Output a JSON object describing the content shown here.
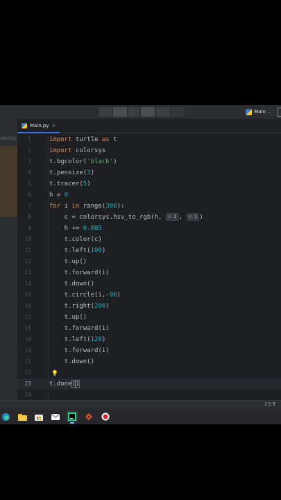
{
  "toolbar": {
    "run_config_label": "Main"
  },
  "project_panel": {
    "label": "ojects/p"
  },
  "tab": {
    "filename": "Main.py",
    "close_glyph": "×"
  },
  "editor": {
    "line_numbers": [
      "1",
      "2",
      "3",
      "4",
      "5",
      "6",
      "7",
      "8",
      "9",
      "10",
      "11",
      "12",
      "13",
      "14",
      "15",
      "16",
      "17",
      "18",
      "19",
      "20",
      "21",
      "22",
      "23",
      "24"
    ],
    "current_line": 23,
    "code_lines": [
      "import turtle as t",
      "import colorsys",
      "t.bgcolor('black')",
      "t.pensize(3)",
      "t.tracer(5)",
      "h = 0",
      "for i in range(300):",
      "    c = colorsys.hsv_to_rgb(h, s: 1, v: 1)",
      "    h += 0.005",
      "    t.color(c)",
      "    t.left(100)",
      "    t.up()",
      "    t.forward(i)",
      "    t.down()",
      "    t.circle(i,-90)",
      "    t.right(200)",
      "    t.up()",
      "    t.forward(i)",
      "    t.left(120)",
      "    t.forward(i)",
      "    t.down()",
      "",
      "t.done()",
      ""
    ]
  },
  "statusbar": {
    "caret_position": "23:9"
  },
  "taskbar": {
    "icons": [
      "edge-icon",
      "file-explorer-icon",
      "store-icon",
      "mail-icon",
      "pycharm-icon",
      "app-icon",
      "record-icon"
    ]
  },
  "colors": {
    "keyword": "#cf8e6d",
    "number": "#2aacb8",
    "string": "#6aab73",
    "function": "#56a8f5",
    "editor_bg": "#1e1f22"
  }
}
